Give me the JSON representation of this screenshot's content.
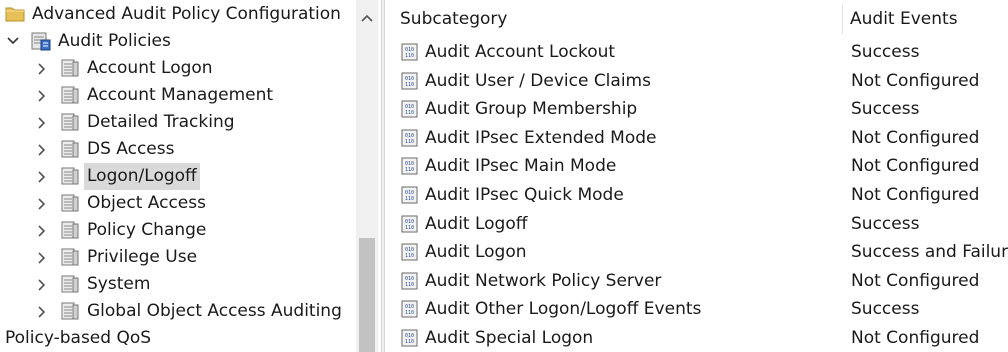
{
  "tree": {
    "root": {
      "label": "Advanced Audit Policy Configuration",
      "icon": "folder-icon"
    },
    "policies": {
      "label": "Audit Policies",
      "icon": "audit-policies-icon"
    },
    "categories": [
      {
        "label": "Account Logon"
      },
      {
        "label": "Account Management"
      },
      {
        "label": "Detailed Tracking"
      },
      {
        "label": "DS Access"
      },
      {
        "label": "Logon/Logoff",
        "selected": true
      },
      {
        "label": "Object Access"
      },
      {
        "label": "Policy Change"
      },
      {
        "label": "Privilege Use"
      },
      {
        "label": "System"
      },
      {
        "label": "Global Object Access Auditing"
      }
    ],
    "footer": {
      "label": "Policy-based QoS"
    }
  },
  "list": {
    "columns": {
      "subcategory": "Subcategory",
      "events": "Audit Events"
    },
    "rows": [
      {
        "name": "Audit Account Lockout",
        "events": "Success"
      },
      {
        "name": "Audit User / Device Claims",
        "events": "Not Configured"
      },
      {
        "name": "Audit Group Membership",
        "events": "Success"
      },
      {
        "name": "Audit IPsec Extended Mode",
        "events": "Not Configured"
      },
      {
        "name": "Audit IPsec Main Mode",
        "events": "Not Configured"
      },
      {
        "name": "Audit IPsec Quick Mode",
        "events": "Not Configured"
      },
      {
        "name": "Audit Logoff",
        "events": "Success"
      },
      {
        "name": "Audit Logon",
        "events": "Success and Failure"
      },
      {
        "name": "Audit Network Policy Server",
        "events": "Not Configured"
      },
      {
        "name": "Audit Other Logon/Logoff Events",
        "events": "Success"
      },
      {
        "name": "Audit Special Logon",
        "events": "Not Configured"
      }
    ]
  }
}
